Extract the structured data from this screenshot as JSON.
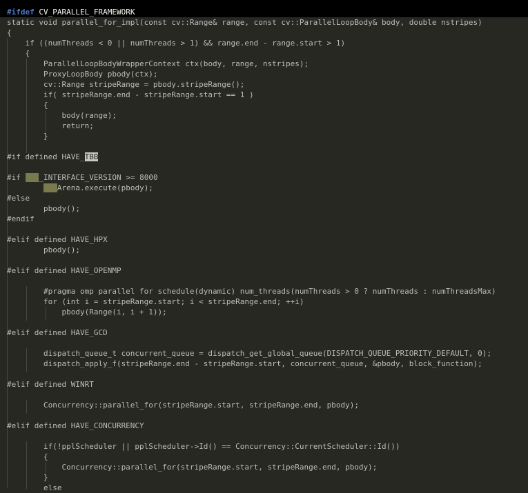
{
  "editor": {
    "lines": [
      "static void parallel_for_impl(const cv::Range& range, const cv::ParallelLoopBody& body, double nstripes)",
      "{",
      "    if ((numThreads < 0 || numThreads > 1) && range.end - range.start > 1)",
      "    {",
      "        ParallelLoopBodyWrapperContext ctx(body, range, nstripes);",
      "        ProxyLoopBody pbody(ctx);",
      "        cv::Range stripeRange = pbody.stripeRange();",
      "        if( stripeRange.end - stripeRange.start == 1 )",
      "        {",
      "            body(range);",
      "            return;",
      "        }",
      "",
      "#if defined HAVE_",
      "",
      "#if ",
      "",
      "#else",
      "        pbody();",
      "#endif",
      "",
      "#elif defined HAVE_HPX",
      "        pbody();",
      "",
      "#elif defined HAVE_OPENMP",
      "",
      "        #pragma omp parallel for schedule(dynamic) num_threads(numThreads > 0 ? numThreads : numThreadsMax)",
      "        for (int i = stripeRange.start; i < stripeRange.end; ++i)",
      "            pbody(Range(i, i + 1));",
      "",
      "#elif defined HAVE_GCD",
      "",
      "        dispatch_queue_t concurrent_queue = dispatch_get_global_queue(DISPATCH_QUEUE_PRIORITY_DEFAULT, 0);",
      "        dispatch_apply_f(stripeRange.end - stripeRange.start, concurrent_queue, &pbody, block_function);",
      "",
      "#elif defined WINRT",
      "",
      "        Concurrency::parallel_for(stripeRange.start, stripeRange.end, pbody);",
      "",
      "#elif defined HAVE_CONCURRENCY",
      "",
      "        if(!pplScheduler || pplScheduler->Id() == Concurrency::CurrentScheduler::Id())",
      "        {",
      "            Concurrency::parallel_for(stripeRange.start, stripeRange.end, pbody);",
      "        }",
      "        else"
    ],
    "first_line": {
      "directive": "#ifdef",
      "name": " CV_PARALLEL_FRAMEWORK"
    },
    "tbb_token": "TBB",
    "line15_rest": "_INTERFACE_VERSION >= 8000",
    "line16_indent": "        ",
    "line16_token": "TBB",
    "line16_rest": "Arena.execute(pbody);",
    "colors": {
      "background": "#272822",
      "top_bar": "#000000",
      "text": "#bcbcbc",
      "preprocessor_keyword": "#4e78c4",
      "search_highlight": "#c9c9bd",
      "search_highlight_dim": "#797a4e",
      "indent_guide": "#464741"
    }
  }
}
